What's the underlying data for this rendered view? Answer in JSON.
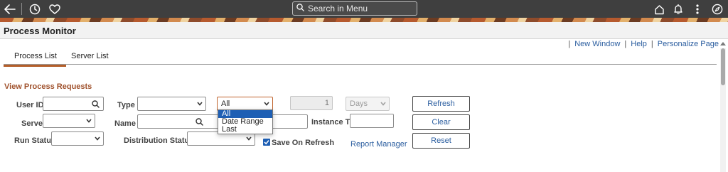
{
  "topbar": {
    "search_placeholder": "Search in Menu",
    "icons": [
      "back-arrow-icon",
      "history-icon",
      "favorites-icon",
      "search-icon",
      "home-icon",
      "notifications-icon",
      "actions-menu-icon",
      "navbar-icon"
    ]
  },
  "page": {
    "title": "Process Monitor"
  },
  "links": {
    "new_window": "New Window",
    "help": "Help",
    "personalize": "Personalize Page"
  },
  "tabs": [
    {
      "label": "Process List",
      "active": true
    },
    {
      "label": "Server List",
      "active": false
    }
  ],
  "section": {
    "title": "View Process Requests"
  },
  "form": {
    "user_id_label": "User ID",
    "user_id_value": "",
    "type_label": "Type",
    "type_value": "",
    "when_value": "All",
    "last_number": "1",
    "period_value": "Days",
    "server_label": "Server",
    "server_value": "",
    "name_label": "Name",
    "name_value": "",
    "instance_to_label": "Instance To",
    "instance_to_value": "",
    "run_status_label": "Run Status",
    "run_status_value": "",
    "distribution_status_label": "Distribution Status",
    "distribution_status_value": "",
    "save_on_refresh_label": "Save On Refresh",
    "save_on_refresh_checked": true,
    "report_manager_link": "Report Manager"
  },
  "buttons": {
    "refresh": "Refresh",
    "clear": "Clear",
    "reset": "Reset"
  },
  "when_dropdown": {
    "options": [
      "All",
      "Date Range",
      "Last"
    ],
    "selected": "All"
  },
  "colors": {
    "topbar": "#3f3f3f",
    "accent": "#b45f2a",
    "section_title": "#a0522d",
    "link": "#2a5d9f",
    "selected_option": "#1e5fb4"
  }
}
